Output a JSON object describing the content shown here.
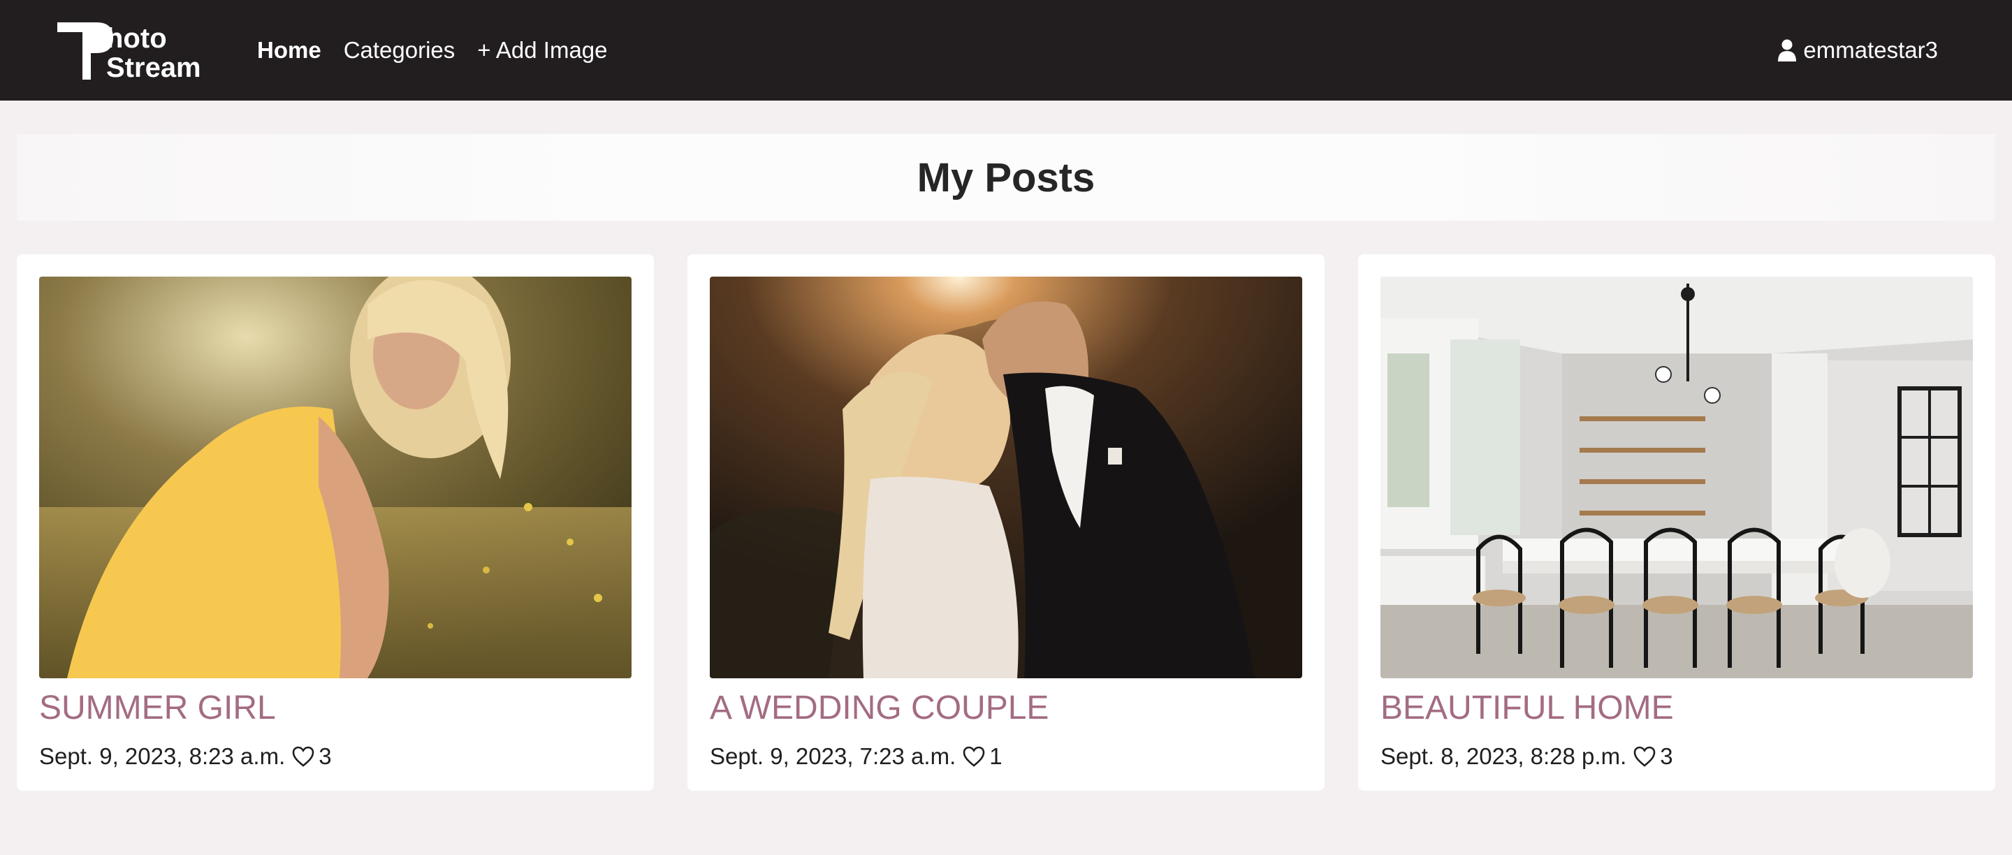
{
  "brand": {
    "line1": "hoto",
    "line2": "Stream"
  },
  "nav": {
    "items": [
      {
        "label": "Home",
        "active": true
      },
      {
        "label": "Categories",
        "active": false
      },
      {
        "label": "+ Add Image",
        "active": false
      }
    ],
    "user": "emmatestar3"
  },
  "page": {
    "title": "My Posts"
  },
  "posts": [
    {
      "title": "SUMMER GIRL",
      "date": "Sept. 9, 2023, 8:23 a.m.",
      "likes": "3",
      "icon": "heart-outline-icon"
    },
    {
      "title": "A WEDDING COUPLE",
      "date": "Sept. 9, 2023, 7:23 a.m.",
      "likes": "1",
      "icon": "heart-outline-icon"
    },
    {
      "title": "BEAUTIFUL HOME",
      "date": "Sept. 8, 2023, 8:28 p.m.",
      "likes": "3",
      "icon": "heart-outline-icon"
    }
  ],
  "colors": {
    "navbar": "#221e1f",
    "background": "#f4f0f1",
    "post_title": "#a36c83"
  }
}
